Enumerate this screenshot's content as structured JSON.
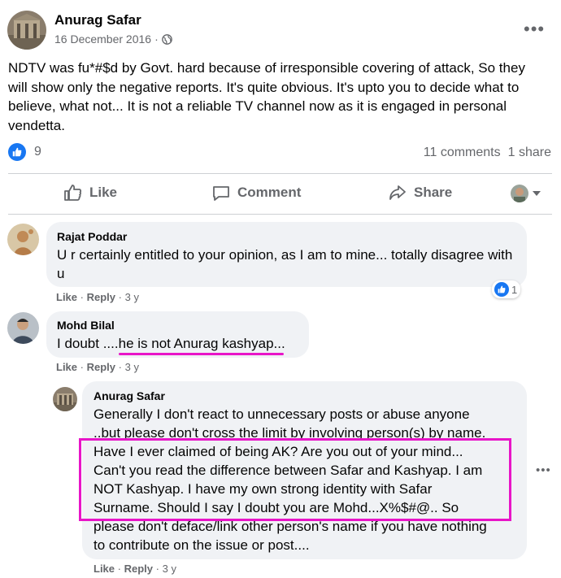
{
  "post": {
    "author": "Anurag Safar",
    "date": "16 December 2016",
    "separator": "·",
    "privacy_icon": "globe-icon",
    "more_icon": "more-options-icon",
    "more_label": "•••",
    "text": "NDTV was fu*#$d by Govt. hard because of irresponsible covering of attack, So they will show only the negative reports. It's quite obvious. It's upto you to decide what to believe, what not... It is not a reliable TV channel now as it is engaged in personal vendetta.",
    "reaction_count": "9",
    "comments_count": "11 comments",
    "shares_count": "1 share"
  },
  "actions": {
    "like": "Like",
    "comment": "Comment",
    "share": "Share"
  },
  "comments": [
    {
      "author": "Rajat Poddar",
      "text": "U r certainly entitled to your opinion, as I am to mine... totally disagree with u",
      "like_label": "Like",
      "reply_label": "Reply",
      "separator": "·",
      "time": "3 y",
      "reaction_count": "1"
    },
    {
      "author": "Mohd Bilal",
      "text_before": "I doubt ....",
      "text_highlight": "he is not Anurag kashyap...",
      "like_label": "Like",
      "reply_label": "Reply",
      "separator": "·",
      "time": "3 y"
    }
  ],
  "reply": {
    "author": "Anurag Safar",
    "lines": [
      "Generally I don't react to unnecessary posts or abuse anyone",
      "..but please don't cross the limit by involving person(s) by name.",
      "Have I ever claimed of being AK? Are you out of your mind...",
      "Can't you read the difference between Safar and Kashyap. I am",
      "NOT Kashyap. I have my own strong identity with Safar",
      "Surname. Should I say I doubt you are Mohd...X%$#@.. So",
      "please don't deface/link other person's name if you have nothing",
      "to contribute on the issue or post...."
    ],
    "like_label": "Like",
    "reply_label": "Reply",
    "separator": "·",
    "time": "3 y",
    "more_label": "•••"
  },
  "colors": {
    "accent": "#1877f2",
    "highlight": "#e815c8",
    "bubble": "#f0f2f5",
    "secondary_text": "#65676b"
  }
}
